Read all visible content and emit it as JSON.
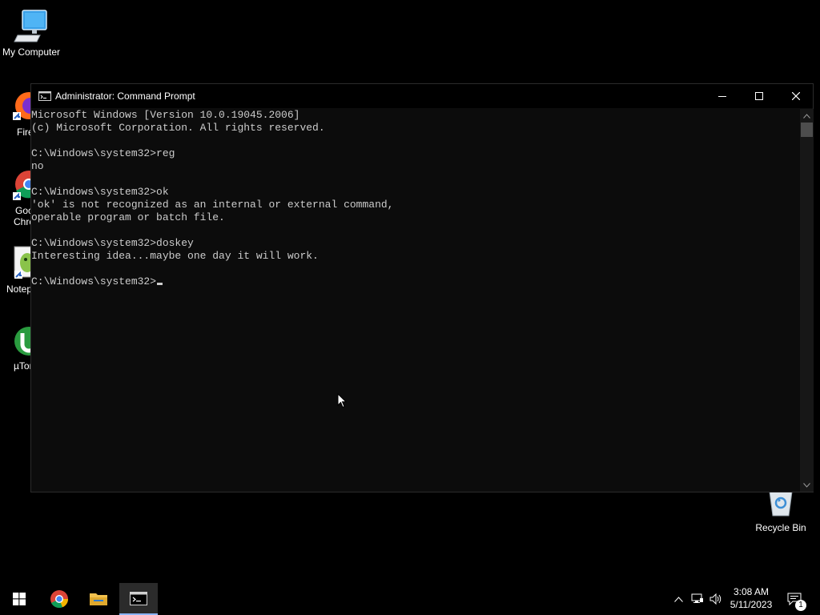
{
  "desktop": {
    "icons": [
      {
        "label": "My Computer",
        "icon": "computer-icon"
      },
      {
        "label": "Fire",
        "icon": "firefox-icon"
      },
      {
        "label": "Goc",
        "sublabel": "Chro",
        "icon": "chrome-icon"
      },
      {
        "label": "Notep",
        "icon": "notepad-icon"
      },
      {
        "label": "µTor",
        "icon": "utorrent-icon"
      },
      {
        "label": "Recycle Bin",
        "icon": "recycle-bin-icon"
      }
    ]
  },
  "window": {
    "title": "Administrator: Command Prompt",
    "console_lines": [
      "Microsoft Windows [Version 10.0.19045.2006]",
      "(c) Microsoft Corporation. All rights reserved.",
      "",
      "C:\\Windows\\system32>reg",
      "no",
      "",
      "C:\\Windows\\system32>ok",
      "'ok' is not recognized as an internal or external command,",
      "operable program or batch file.",
      "",
      "C:\\Windows\\system32>doskey",
      "Interesting idea...maybe one day it will work.",
      ""
    ],
    "prompt": "C:\\Windows\\system32>"
  },
  "taskbar": {
    "items": [
      {
        "name": "start",
        "icon": "windows-logo-icon"
      },
      {
        "name": "chrome",
        "icon": "chrome-icon"
      },
      {
        "name": "file-explorer",
        "icon": "folder-icon"
      },
      {
        "name": "command-prompt",
        "icon": "cmd-icon",
        "active": true
      }
    ],
    "tray": {
      "time": "3:08 AM",
      "date": "5/11/2023",
      "notifications": "1"
    }
  },
  "colors": {
    "console_bg": "#0c0c0c",
    "console_text": "#cccccc",
    "active_indicator": "#8ab4f8"
  }
}
